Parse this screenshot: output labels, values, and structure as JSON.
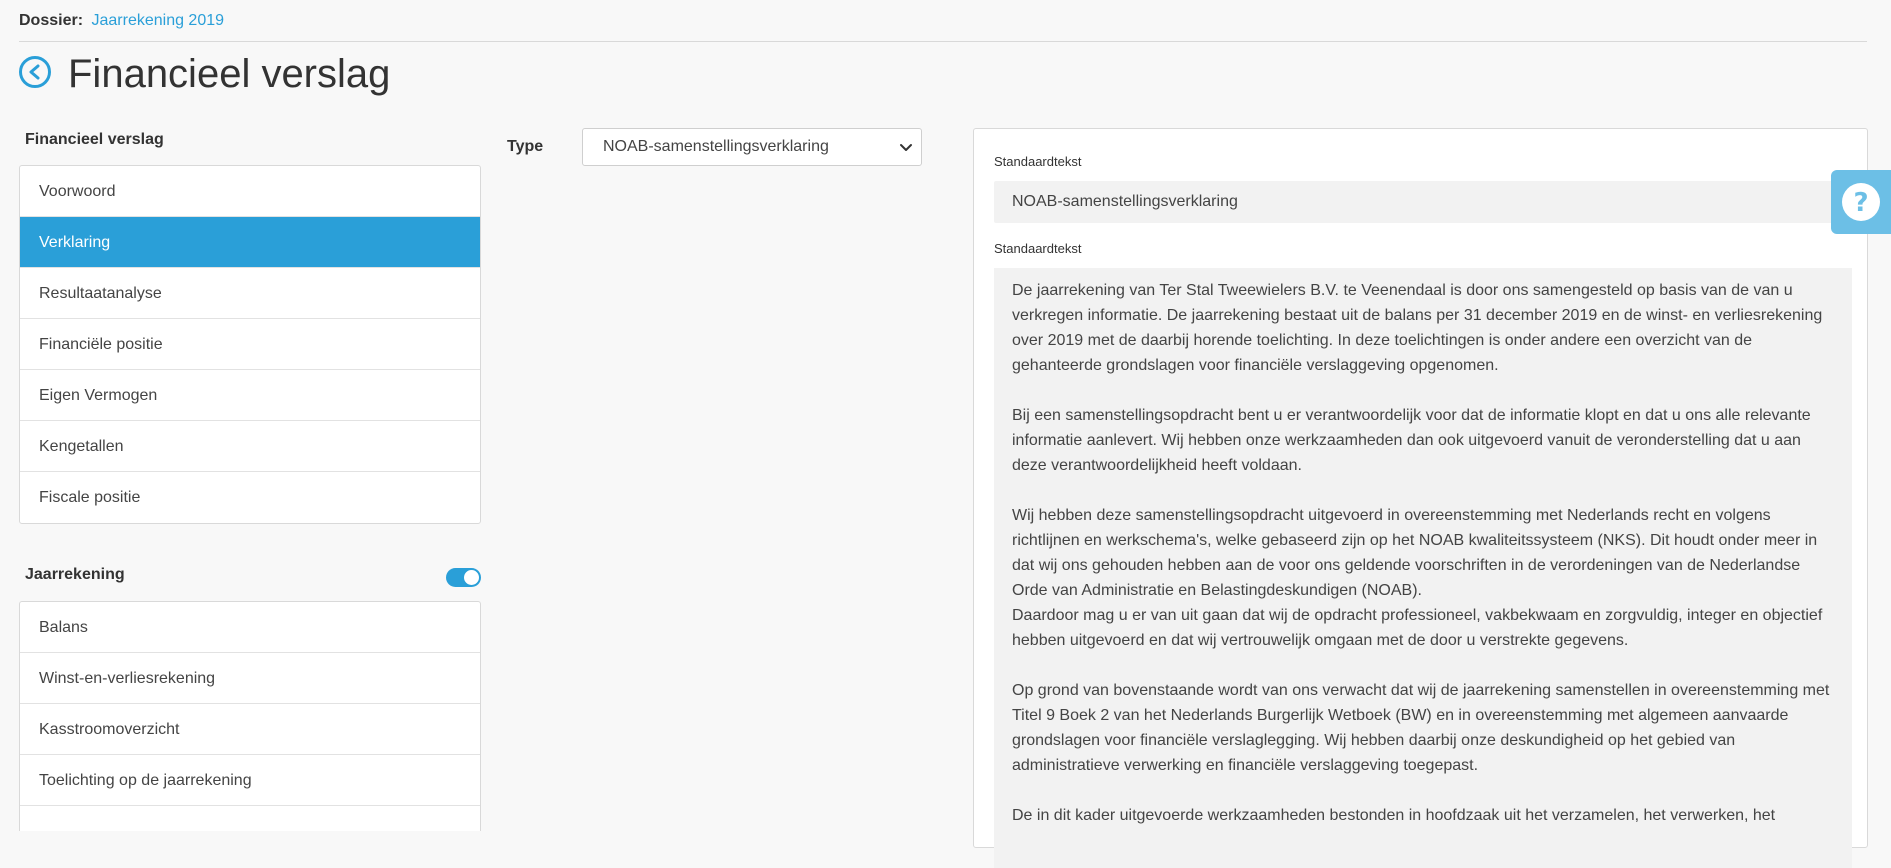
{
  "header": {
    "dossier_label": "Dossier:",
    "dossier_link": "Jaarrekening 2019",
    "title": "Financieel verslag"
  },
  "sidebar": {
    "section1_title": "Financieel verslag",
    "items1": [
      "Voorwoord",
      "Verklaring",
      "Resultaatanalyse",
      "Financiële positie",
      "Eigen Vermogen",
      "Kengetallen",
      "Fiscale positie"
    ],
    "active_item": "Verklaring",
    "section2_title": "Jaarrekening",
    "toggle_on": true,
    "items2": [
      "Balans",
      "Winst-en-verliesrekening",
      "Kasstroomoverzicht",
      "Toelichting op de jaarrekening"
    ]
  },
  "type_field": {
    "label": "Type",
    "value": "NOAB-samenstellingsverklaring"
  },
  "panel": {
    "label1": "Standaardtekst",
    "value1": "NOAB-samenstellingsverklaring",
    "label2": "Standaardtekst",
    "paragraphs": [
      "De jaarrekening van Ter Stal Tweewielers B.V. te Veenendaal is door ons samengesteld op basis van de van u verkregen informatie. De jaarrekening bestaat uit de balans per 31 december 2019 en de winst- en verliesrekening over 2019 met de daarbij horende toelichting. In deze toelichtingen is onder andere een overzicht van de gehanteerde grondslagen voor financiële verslaggeving opgenomen.",
      "Bij een samenstellingsopdracht bent u er verantwoordelijk voor dat de informatie klopt en dat u ons alle relevante informatie aanlevert. Wij hebben onze werkzaamheden dan ook uitgevoerd vanuit de veronderstelling dat u aan deze verantwoordelijkheid heeft voldaan.",
      "Wij hebben deze samenstellingsopdracht uitgevoerd in overeenstemming met Nederlands recht en volgens richtlijnen en werkschema's, welke gebaseerd zijn op het NOAB kwaliteitssysteem (NKS). Dit houdt onder meer in dat wij ons gehouden hebben aan de voor ons geldende voorschriften in de verordeningen van de Nederlandse Orde van Administratie en Belastingdeskundigen (NOAB).",
      "Daardoor mag u er van uit gaan dat wij de opdracht professioneel, vakbekwaam en zorgvuldig, integer en objectief hebben uitgevoerd en dat wij vertrouwelijk omgaan met de door u verstrekte gegevens.",
      "Op grond van bovenstaande wordt van ons verwacht dat wij de jaarrekening samenstellen in overeenstemming met Titel 9 Boek 2 van het Nederlands Burgerlijk Wetboek (BW) en in overeenstemming met algemeen aanvaarde grondslagen voor financiële verslaglegging. Wij hebben daarbij onze deskundigheid op het gebied van administratieve verwerking en financiële verslaggeving toegepast.",
      "De in dit kader uitgevoerde werkzaamheden bestonden in hoofdzaak uit het verzamelen, het verwerken, het"
    ]
  },
  "icons": {
    "back": "chevron-left-circle-icon",
    "help": "question-circle-icon",
    "dropdown": "chevron-down-icon"
  },
  "colors": {
    "accent": "#2a9fd8",
    "help_bg": "#6cbfe6"
  }
}
